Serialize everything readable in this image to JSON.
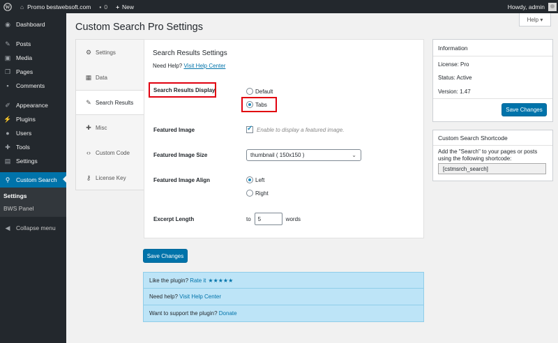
{
  "adminbar": {
    "site_name": "Promo bestwebsoft.com",
    "comments_count": "0",
    "new_label": "New",
    "howdy": "Howdy, admin"
  },
  "sidebar": {
    "items": [
      {
        "label": "Dashboard",
        "icon": "dashboard-icon"
      },
      {
        "label": "Posts",
        "icon": "pin-icon"
      },
      {
        "label": "Media",
        "icon": "media-icon"
      },
      {
        "label": "Pages",
        "icon": "pages-icon"
      },
      {
        "label": "Comments",
        "icon": "comment-icon"
      },
      {
        "label": "Appearance",
        "icon": "brush-icon"
      },
      {
        "label": "Plugins",
        "icon": "plug-icon"
      },
      {
        "label": "Users",
        "icon": "user-icon"
      },
      {
        "label": "Tools",
        "icon": "wrench-icon"
      },
      {
        "label": "Settings",
        "icon": "sliders-icon"
      },
      {
        "label": "Custom Search",
        "icon": "search-icon"
      }
    ],
    "submenu": [
      "Settings",
      "BWS Panel"
    ],
    "collapse": "Collapse menu"
  },
  "help_tab": "Help ▾",
  "page_title": "Custom Search Pro Settings",
  "tabs": [
    {
      "label": "Settings",
      "icon": "gear-icon"
    },
    {
      "label": "Data",
      "icon": "table-icon"
    },
    {
      "label": "Search Results",
      "icon": "pin-icon"
    },
    {
      "label": "Misc",
      "icon": "wrench-icon"
    },
    {
      "label": "Custom Code",
      "icon": "code-icon"
    },
    {
      "label": "License Key",
      "icon": "key-icon"
    }
  ],
  "main": {
    "title": "Search Results Settings",
    "need_help": "Need Help?",
    "help_link": "Visit Help Center",
    "display_label": "Search Results Display",
    "display_options": [
      "Default",
      "Tabs"
    ],
    "display_selected": "Tabs",
    "featured_image_label": "Featured Image",
    "featured_image_hint": "Enable to display a featured image.",
    "featured_image_size_label": "Featured Image Size",
    "featured_image_size_value": "thumbnail ( 150x150 )",
    "featured_image_align_label": "Featured Image Align",
    "align_options": [
      "Left",
      "Right"
    ],
    "align_selected": "Left",
    "excerpt_label": "Excerpt Length",
    "excerpt_to": "to",
    "excerpt_value": "5",
    "excerpt_unit": "words"
  },
  "save_button": "Save Changes",
  "notices": {
    "like": "Like the plugin?",
    "rate": "Rate it",
    "stars": "★★★★★",
    "need_help": "Need help?",
    "help_center": "Visit Help Center",
    "support": "Want to support the plugin?",
    "donate": "Donate"
  },
  "info_box": {
    "title": "Information",
    "license": "License: Pro",
    "status": "Status: Active",
    "version": "Version: 1.47",
    "save": "Save Changes"
  },
  "shortcode_box": {
    "title": "Custom Search Shortcode",
    "description": "Add the \"Search\" to your pages or posts using the following shortcode:",
    "shortcode": "[cstmsrch_search]"
  },
  "colors": {
    "accent": "#0073aa",
    "highlight": "#e1000f",
    "adminbar": "#23282d",
    "notice_bg": "#bde4f7"
  }
}
